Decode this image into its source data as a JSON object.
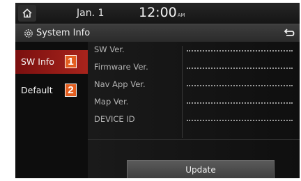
{
  "status": {
    "home_icon": "home-icon",
    "date": "Jan. 1",
    "time": "12:00",
    "ampm": "AM"
  },
  "title_bar": {
    "icon": "gear-icon",
    "title": "System Info",
    "back_icon": "back-icon"
  },
  "sidebar": {
    "items": [
      {
        "label": "SW Info",
        "badge": "1",
        "active": true
      },
      {
        "label": "Default",
        "badge": "2",
        "active": false
      }
    ]
  },
  "info": {
    "rows": [
      {
        "label": "SW Ver."
      },
      {
        "label": "Firmware Ver."
      },
      {
        "label": "Nav App Ver."
      },
      {
        "label": "Map Ver."
      },
      {
        "label": "DEVICE ID"
      }
    ]
  },
  "actions": {
    "update_label": "Update"
  },
  "colors": {
    "accent_red": "#a8241c",
    "badge_orange": "#e35e1f",
    "background": "#101010"
  }
}
